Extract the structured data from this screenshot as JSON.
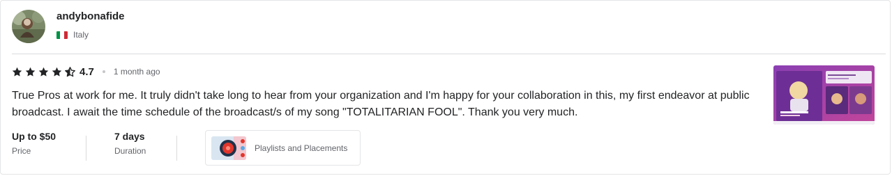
{
  "reviewer": {
    "username": "andybonafide",
    "country": "Italy",
    "flag_colors": [
      "#009246",
      "#ffffff",
      "#ce2b37"
    ]
  },
  "review": {
    "rating": "4.7",
    "rating_stars": 4.5,
    "time_ago": "1 month ago",
    "text": "True Pros at work for me. It truly didn't take long to hear from your organization and I'm happy for your collaboration in this, my first endeavor at public broadcast. I await the time schedule of the broadcast/s of my song \"TOTALITARIAN FOOL\". Thank you very much."
  },
  "order": {
    "price_value": "Up to $50",
    "price_label": "Price",
    "duration_value": "7 days",
    "duration_label": "Duration"
  },
  "service": {
    "name": "Playlists and Placements"
  },
  "colors": {
    "text_primary": "#222325",
    "text_secondary": "#62646a",
    "border": "#e4e5e7"
  }
}
